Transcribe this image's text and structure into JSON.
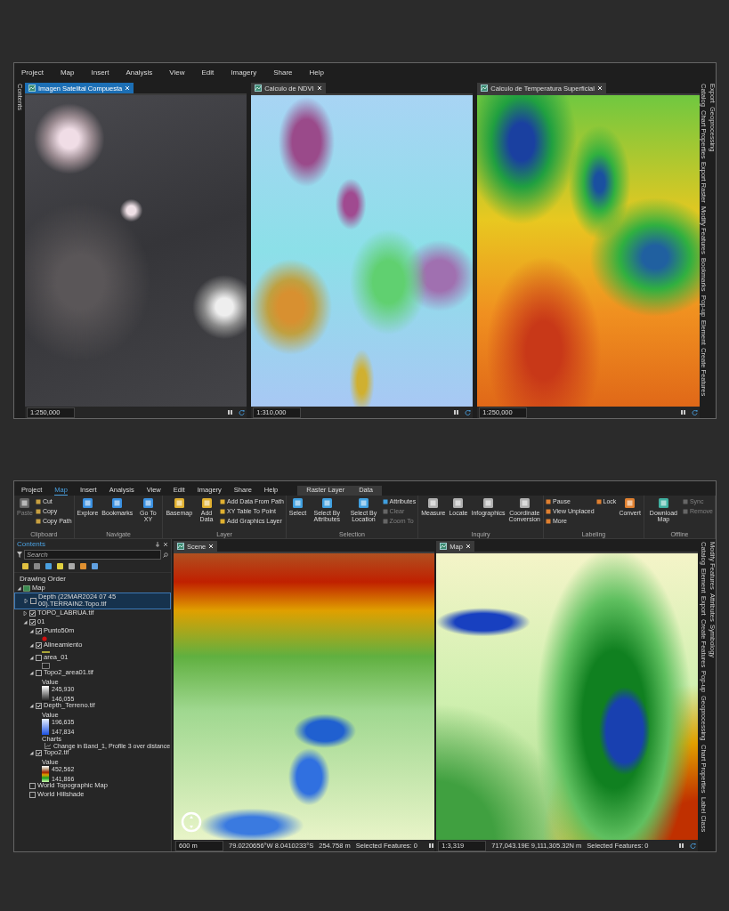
{
  "top_window": {
    "menu": [
      "Project",
      "Map",
      "Insert",
      "Analysis",
      "View",
      "Edit",
      "Imagery",
      "Share",
      "Help"
    ],
    "left_tab": "Contents",
    "views": [
      {
        "title": "Imagen Satelital Compuesta",
        "selected": true,
        "kind": "satellite",
        "status": [
          "1:250,000"
        ]
      },
      {
        "title": "Calculo de NDVI",
        "selected": false,
        "kind": "ndvi",
        "status": [
          "1:310,000"
        ]
      },
      {
        "title": "Calculo de Temperatura Superficial",
        "selected": false,
        "kind": "temperature",
        "status": [
          "1:250,000"
        ]
      }
    ],
    "right_tabs": [
      "Catalog",
      "Chart Properties",
      "Export Raster",
      "Modify Features",
      "Bookmarks",
      "Pop-up",
      "Element",
      "Create Features",
      "Export",
      "Geoprocessing"
    ]
  },
  "bottom_window": {
    "menu": [
      {
        "label": "Project",
        "selected": false
      },
      {
        "label": "Map",
        "selected": true
      },
      {
        "label": "Insert",
        "selected": false
      },
      {
        "label": "Analysis",
        "selected": false
      },
      {
        "label": "View",
        "selected": false
      },
      {
        "label": "Edit",
        "selected": false
      },
      {
        "label": "Imagery",
        "selected": false
      },
      {
        "label": "Share",
        "selected": false
      },
      {
        "label": "Help",
        "selected": false
      }
    ],
    "contextual_tabs": [
      "Raster Layer",
      "Data"
    ],
    "ribbon": [
      {
        "group": "Clipboard",
        "tools": [
          {
            "label": "Paste",
            "kind": "large",
            "disabled": true
          },
          {
            "label": "Cut",
            "kind": "small",
            "disabled": false
          },
          {
            "label": "Copy",
            "kind": "small",
            "disabled": false
          },
          {
            "label": "Copy Path",
            "kind": "small",
            "disabled": false
          }
        ]
      },
      {
        "group": "Navigate",
        "tools": [
          {
            "label": "Explore",
            "kind": "large",
            "disabled": false
          },
          {
            "label": "Bookmarks",
            "kind": "large",
            "disabled": false
          },
          {
            "label": "Go To XY",
            "kind": "large",
            "disabled": false
          }
        ]
      },
      {
        "group": "Layer",
        "tools": [
          {
            "label": "Basemap",
            "kind": "large",
            "disabled": false
          },
          {
            "label": "Add Data",
            "kind": "large",
            "disabled": false
          },
          {
            "label": "Add Data From Path",
            "kind": "small",
            "disabled": false
          },
          {
            "label": "XY Table To Point",
            "kind": "small",
            "disabled": false
          },
          {
            "label": "Add Graphics Layer",
            "kind": "small",
            "disabled": false
          }
        ]
      },
      {
        "group": "Selection",
        "tools": [
          {
            "label": "Select",
            "kind": "large",
            "disabled": false
          },
          {
            "label": "Select By Attributes",
            "kind": "large",
            "disabled": false
          },
          {
            "label": "Select By Location",
            "kind": "large",
            "disabled": false
          },
          {
            "label": "Attributes",
            "kind": "small",
            "disabled": false
          },
          {
            "label": "Clear",
            "kind": "small",
            "disabled": true
          },
          {
            "label": "Zoom To",
            "kind": "small",
            "disabled": true
          }
        ]
      },
      {
        "group": "Inquiry",
        "tools": [
          {
            "label": "Measure",
            "kind": "large",
            "disabled": false
          },
          {
            "label": "Locate",
            "kind": "large",
            "disabled": false
          },
          {
            "label": "Infographics",
            "kind": "large",
            "disabled": false
          },
          {
            "label": "Coordinate Conversion",
            "kind": "large",
            "disabled": false
          }
        ]
      },
      {
        "group": "Labeling",
        "tools": [
          {
            "label": "Pause",
            "kind": "small",
            "disabled": false
          },
          {
            "label": "View Unplaced",
            "kind": "small",
            "disabled": false
          },
          {
            "label": "More",
            "kind": "small",
            "disabled": false
          },
          {
            "label": "Lock",
            "kind": "small",
            "disabled": false
          },
          {
            "label": "Convert",
            "kind": "large",
            "disabled": false
          }
        ]
      },
      {
        "group": "Offline",
        "tools": [
          {
            "label": "Download Map",
            "kind": "large",
            "disabled": false
          },
          {
            "label": "Sync",
            "kind": "small",
            "disabled": true
          },
          {
            "label": "Remove",
            "kind": "small",
            "disabled": true
          }
        ]
      }
    ],
    "contents": {
      "title": "Contents",
      "search": {
        "placeholder": "Search"
      },
      "heading": "Drawing Order",
      "layers": [
        {
          "label": "Map",
          "expanded": true,
          "selected": false,
          "children": [
            {
              "label": "Depth (22MAR2024 07 45 00).TERRAIN2.Topo.tif",
              "expanded": false,
              "checked": false,
              "selected": true
            },
            {
              "label": "TOPO_LABRUA.tif",
              "expanded": false,
              "checked": true,
              "selected": false
            },
            {
              "label": "01",
              "expanded": true,
              "checked": true,
              "selected": false,
              "children": [
                {
                  "label": "Punto50m",
                  "expanded": true,
                  "checked": true,
                  "selected": false,
                  "legend": {
                    "kind": "point"
                  }
                },
                {
                  "label": "Alineamiento",
                  "expanded": true,
                  "checked": true,
                  "selected": false,
                  "legend": {
                    "kind": "line"
                  }
                },
                {
                  "label": "area_01",
                  "expanded": true,
                  "checked": false,
                  "selected": false,
                  "legend": {
                    "kind": "polygon"
                  }
                },
                {
                  "label": "Topo2_area01.tif",
                  "expanded": true,
                  "checked": false,
                  "selected": false,
                  "legend": {
                    "kind": "gray_ramp",
                    "heading": "Value",
                    "high": "245,930",
                    "low": "146,055"
                  }
                },
                {
                  "label": "Depth_Terreno.tif",
                  "expanded": true,
                  "checked": true,
                  "selected": false,
                  "legend": {
                    "kind": "blue_ramp",
                    "heading": "Value",
                    "high": "196,635",
                    "low": "147,834"
                  },
                  "charts": {
                    "heading": "Charts",
                    "item": "Change in Band_1, Profile 3 over distance"
                  }
                },
                {
                  "label": "Topo2.tif",
                  "expanded": true,
                  "checked": true,
                  "selected": false,
                  "legend": {
                    "kind": "terrain_ramp",
                    "heading": "Value",
                    "high": "452,562",
                    "low": "141,866"
                  }
                }
              ]
            },
            {
              "label": "World Topographic Map",
              "checked": false,
              "selected": false
            },
            {
              "label": "World Hillshade",
              "checked": false,
              "selected": false
            }
          ]
        }
      ]
    },
    "views": [
      {
        "title": "Scene",
        "kind": "scene",
        "status": [
          "600 m",
          "79.0220656°W 8.0410233°S",
          "254.758 m",
          "Selected Features: 0"
        ]
      },
      {
        "title": "Map",
        "kind": "map",
        "status": [
          "1:3,319",
          "717,043.19E 9,111,305.32N m",
          "Selected Features: 0"
        ]
      }
    ],
    "right_tabs": [
      "Catalog",
      "Element",
      "Export",
      "Create Features",
      "Pop-up",
      "Geoprocessing",
      "Chart Properties",
      "Label Class",
      "Modify Features",
      "Attributes",
      "Symbology"
    ]
  }
}
